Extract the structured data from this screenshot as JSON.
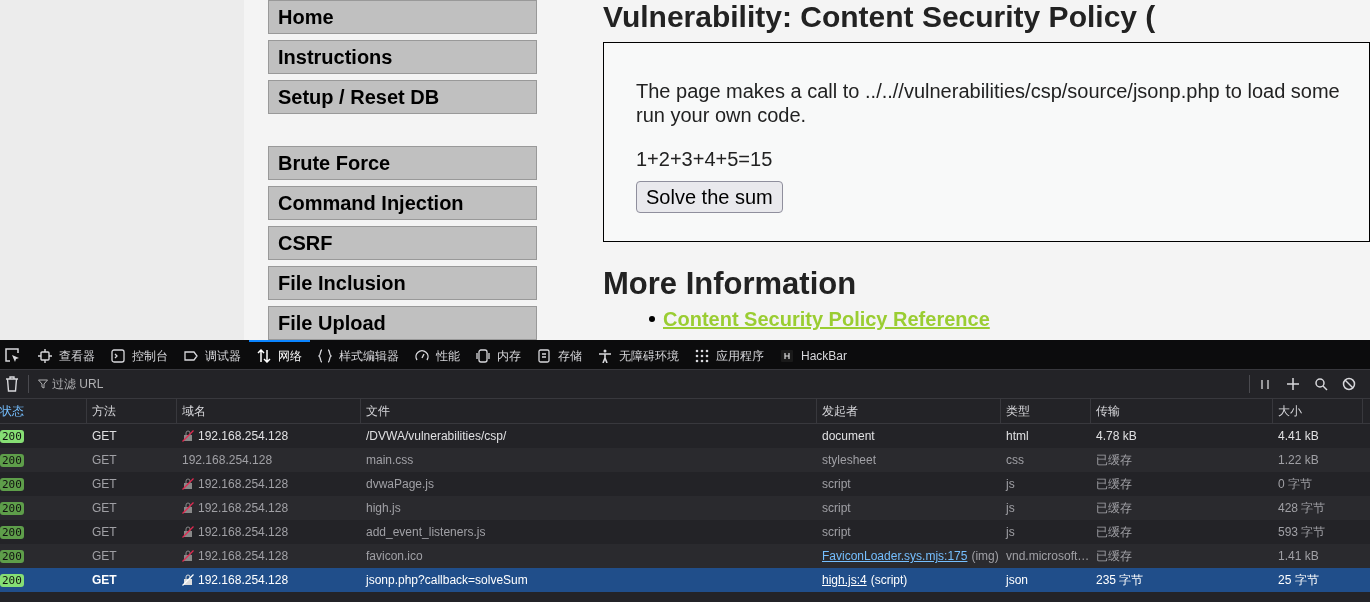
{
  "sidebar": {
    "groups": [
      [
        "Home",
        "Instructions",
        "Setup / Reset DB"
      ],
      [
        "Brute Force",
        "Command Injection",
        "CSRF",
        "File Inclusion",
        "File Upload"
      ]
    ]
  },
  "main": {
    "title": "Vulnerability: Content Security Policy (",
    "box": {
      "lines": [
        "The page makes a call to ../..//vulnerabilities/csp/source/jsonp.php to load some",
        "run your own code."
      ],
      "sum": "1+2+3+4+5=15",
      "button": "Solve the sum"
    },
    "more_heading": "More Information",
    "links": [
      "Content Security Policy Reference"
    ]
  },
  "devtools": {
    "tabs": [
      {
        "label": "查看器",
        "selected": false
      },
      {
        "label": "控制台",
        "selected": false
      },
      {
        "label": "调试器",
        "selected": false
      },
      {
        "label": "网络",
        "selected": true
      },
      {
        "label": "样式编辑器",
        "selected": false
      },
      {
        "label": "性能",
        "selected": false
      },
      {
        "label": "内存",
        "selected": false
      },
      {
        "label": "存储",
        "selected": false
      },
      {
        "label": "无障碍环境",
        "selected": false
      },
      {
        "label": "应用程序",
        "selected": false
      },
      {
        "label": "HackBar",
        "selected": false
      }
    ],
    "filter": {
      "placeholder": "过滤 URL"
    },
    "columns": [
      "状态",
      "方法",
      "域名",
      "文件",
      "发起者",
      "类型",
      "传输",
      "大小"
    ],
    "rows": [
      {
        "status": "200",
        "method": "GET",
        "insecure": true,
        "domain": "192.168.254.128",
        "file": "/DVWA/vulnerabilities/csp/",
        "initiator": "document",
        "type": "html",
        "transfer": "4.78 kB",
        "size": "4.41 kB",
        "dimmed": false,
        "selected": false
      },
      {
        "status": "200",
        "method": "GET",
        "insecure": false,
        "domain": "192.168.254.128",
        "file": "main.css",
        "initiator": "stylesheet",
        "type": "css",
        "transfer": "已缓存",
        "size": "1.22 kB",
        "dimmed": true,
        "selected": false
      },
      {
        "status": "200",
        "method": "GET",
        "insecure": true,
        "domain": "192.168.254.128",
        "file": "dvwaPage.js",
        "initiator": "script",
        "type": "js",
        "transfer": "已缓存",
        "size": "0 字节",
        "dimmed": true,
        "selected": false
      },
      {
        "status": "200",
        "method": "GET",
        "insecure": true,
        "domain": "192.168.254.128",
        "file": "high.js",
        "initiator": "script",
        "type": "js",
        "transfer": "已缓存",
        "size": "428 字节",
        "dimmed": true,
        "selected": false
      },
      {
        "status": "200",
        "method": "GET",
        "insecure": true,
        "domain": "192.168.254.128",
        "file": "add_event_listeners.js",
        "initiator": "script",
        "type": "js",
        "transfer": "已缓存",
        "size": "593 字节",
        "dimmed": true,
        "selected": false
      },
      {
        "status": "200",
        "method": "GET",
        "insecure": true,
        "domain": "192.168.254.128",
        "file": "favicon.ico",
        "initiator_link": "FaviconLoader.sys.mjs:175",
        "initiator": "(img)",
        "type": "vnd.microsoft…",
        "transfer": "已缓存",
        "size": "1.41 kB",
        "dimmed": true,
        "selected": false
      },
      {
        "status": "200",
        "method": "GET",
        "insecure": true,
        "domain": "192.168.254.128",
        "file": "jsonp.php?callback=solveSum",
        "initiator_link": "high.js:4",
        "initiator": "(script)",
        "type": "json",
        "transfer": "235 字节",
        "size": "25 字节",
        "dimmed": false,
        "selected": true
      }
    ]
  }
}
